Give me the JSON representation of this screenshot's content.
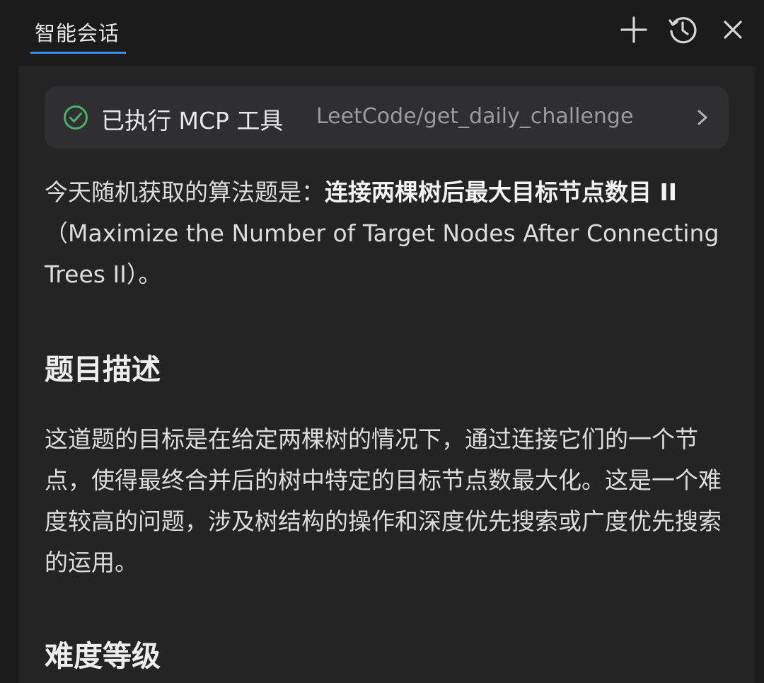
{
  "header": {
    "tab_label": "智能会话",
    "icons": [
      "add-icon",
      "history-icon",
      "close-icon"
    ]
  },
  "mcp": {
    "title": "已执行 MCP 工具",
    "tool_name": "LeetCode/get_daily_challenge",
    "status_color": "#4caf69"
  },
  "intro": {
    "prefix": "今天随机获取的算法题是：",
    "problem_title_cn": "连接两棵树后最大目标节点数目 II",
    "problem_title_en": "（Maximize the Number of Target Nodes After Connecting Trees II）。"
  },
  "section_description": {
    "heading": "题目描述",
    "body": "这道题的目标是在给定两棵树的情况下，通过连接它们的一个节点，使得最终合并后的树中特定的目标节点数最大化。这是一个难度较高的问题，涉及树结构的操作和深度优先搜索或广度优先搜索的运用。"
  },
  "section_difficulty": {
    "heading": "难度等级"
  },
  "colors": {
    "accent": "#3c8ce7",
    "background": "#1b1b1c",
    "panel": "#242425"
  }
}
